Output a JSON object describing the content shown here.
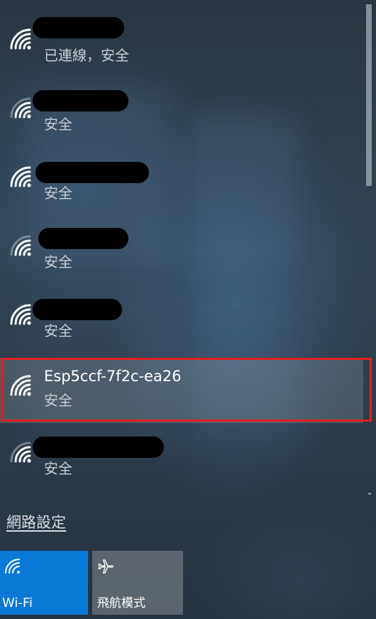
{
  "networks": [
    {
      "name": "",
      "status": "已連線，安全",
      "signal": "full",
      "redacted": true,
      "selected": false
    },
    {
      "name": "",
      "status": "安全",
      "signal": "medium",
      "redacted": true,
      "selected": false
    },
    {
      "name": "",
      "status": "安全",
      "signal": "full",
      "redacted": true,
      "selected": false
    },
    {
      "name": "",
      "status": "安全",
      "signal": "medium",
      "redacted": true,
      "selected": false
    },
    {
      "name": "",
      "status": "安全",
      "signal": "full",
      "redacted": true,
      "selected": false
    },
    {
      "name": "Esp5ccf-7f2c-ea26",
      "status": "安全",
      "signal": "full",
      "redacted": false,
      "selected": true
    },
    {
      "name": "",
      "status": "安全",
      "signal": "medium",
      "redacted": true,
      "selected": false
    }
  ],
  "network_settings_label": "網路設定",
  "quick_actions": {
    "wifi": {
      "label": "Wi-Fi",
      "icon": "wifi-icon",
      "active": true
    },
    "airplane": {
      "label": "飛航模式",
      "icon": "airplane-icon",
      "active": false
    }
  },
  "colors": {
    "accent": "#0a78d7",
    "highlight_border": "#e02020"
  }
}
